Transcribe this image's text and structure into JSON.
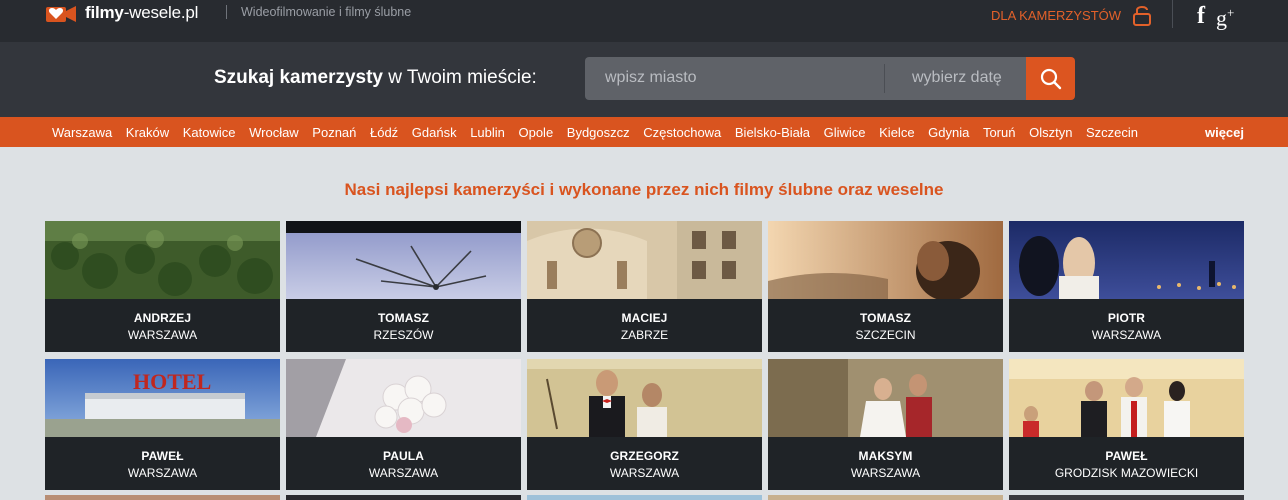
{
  "site": {
    "logo_bold": "filmy",
    "logo_rest": "-wesele.pl",
    "tagline": "Wideofilmowanie i filmy ślubne",
    "camera_link": "DLA KAMERZYSTÓW",
    "accent": "#d9541f"
  },
  "search": {
    "label_bold": "Szukaj kamerzysty",
    "label_rest": " w Twoim mieście:",
    "city_placeholder": "wpisz miasto",
    "date_placeholder": "wybierz datę",
    "button_icon": "search-icon"
  },
  "cities": [
    "Warszawa",
    "Kraków",
    "Katowice",
    "Wrocław",
    "Poznań",
    "Łódź",
    "Gdańsk",
    "Lublin",
    "Opole",
    "Bydgoszcz",
    "Częstochowa",
    "Bielsko-Biała",
    "Gliwice",
    "Kielce",
    "Gdynia",
    "Toruń",
    "Olsztyn",
    "Szczecin"
  ],
  "more_label": "więcej",
  "headline": "Nasi najlepsi kamerzyści i wykonane przez nich filmy ślubne oraz weselne",
  "videographers": [
    {
      "name": "ANDRZEJ",
      "city": "WARSZAWA"
    },
    {
      "name": "TOMASZ",
      "city": "RZESZÓW"
    },
    {
      "name": "MACIEJ",
      "city": "ZABRZE"
    },
    {
      "name": "TOMASZ",
      "city": "SZCZECIN"
    },
    {
      "name": "PIOTR",
      "city": "WARSZAWA"
    },
    {
      "name": "PAWEŁ",
      "city": "WARSZAWA"
    },
    {
      "name": "PAULA",
      "city": "WARSZAWA"
    },
    {
      "name": "GRZEGORZ",
      "city": "WARSZAWA"
    },
    {
      "name": "MAKSYM",
      "city": "WARSZAWA"
    },
    {
      "name": "PAWEŁ",
      "city": "GRODZISK MAZOWIECKI"
    }
  ],
  "hotel_sign": "HOTEL"
}
